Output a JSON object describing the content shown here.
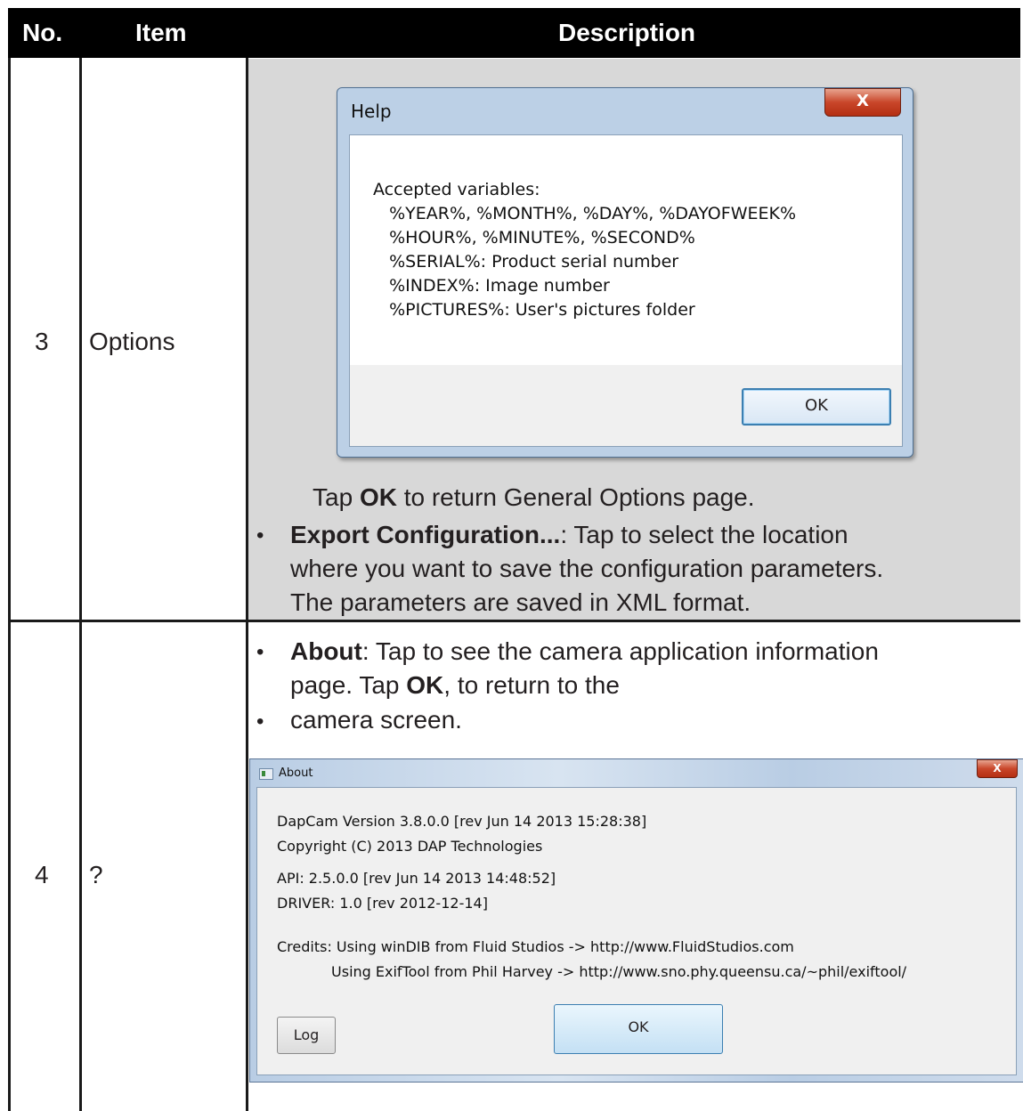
{
  "table": {
    "headers": {
      "no": "No.",
      "item": "Item",
      "description": "Description"
    },
    "rows": [
      {
        "no": "3",
        "item": "Options",
        "help_dialog": {
          "title": "Help",
          "close": "X",
          "lines": [
            "Accepted variables:",
            "   %YEAR%, %MONTH%, %DAY%, %DAYOFWEEK%",
            "   %HOUR%, %MINUTE%, %SECOND%",
            "   %SERIAL%: Product serial number",
            "   %INDEX%: Image number",
            "   %PICTURES%: User's pictures folder"
          ],
          "ok_label": "OK"
        },
        "tap_ok_prefix": "Tap ",
        "tap_ok_bold": "OK",
        "tap_ok_suffix": " to return General Options page.",
        "export_bold": "Export Configuration...",
        "export_line1": ":  Tap to select the location",
        "export_line2": "where you want to save the configuration parameters.",
        "export_line3": "The parameters are saved in XML format."
      },
      {
        "no": "4",
        "item": "?",
        "about_bold": "About",
        "about_line1": ": Tap to see the camera application information",
        "about_line2_prefix": "page. Tap ",
        "about_line2_bold": "OK",
        "about_line2_suffix": ", to return to the",
        "about_line3": "camera screen.",
        "about_dialog": {
          "title": "About",
          "close": "X",
          "version": "DapCam Version 3.8.0.0 [rev Jun 14 2013 15:28:38]",
          "copyright": "Copyright (C) 2013 DAP Technologies",
          "api": "API: 2.5.0.0 [rev Jun 14 2013 14:48:52]",
          "driver": "DRIVER: 1.0 [rev 2012-12-14]",
          "credits1": "Credits: Using winDIB from Fluid Studios -> http://www.FluidStudios.com",
          "credits2": "            Using ExifTool from Phil Harvey -> http://www.sno.phy.queensu.ca/~phil/exiftool/",
          "log_label": "Log",
          "ok_label": "OK"
        }
      }
    ]
  },
  "bullet_char": "•"
}
